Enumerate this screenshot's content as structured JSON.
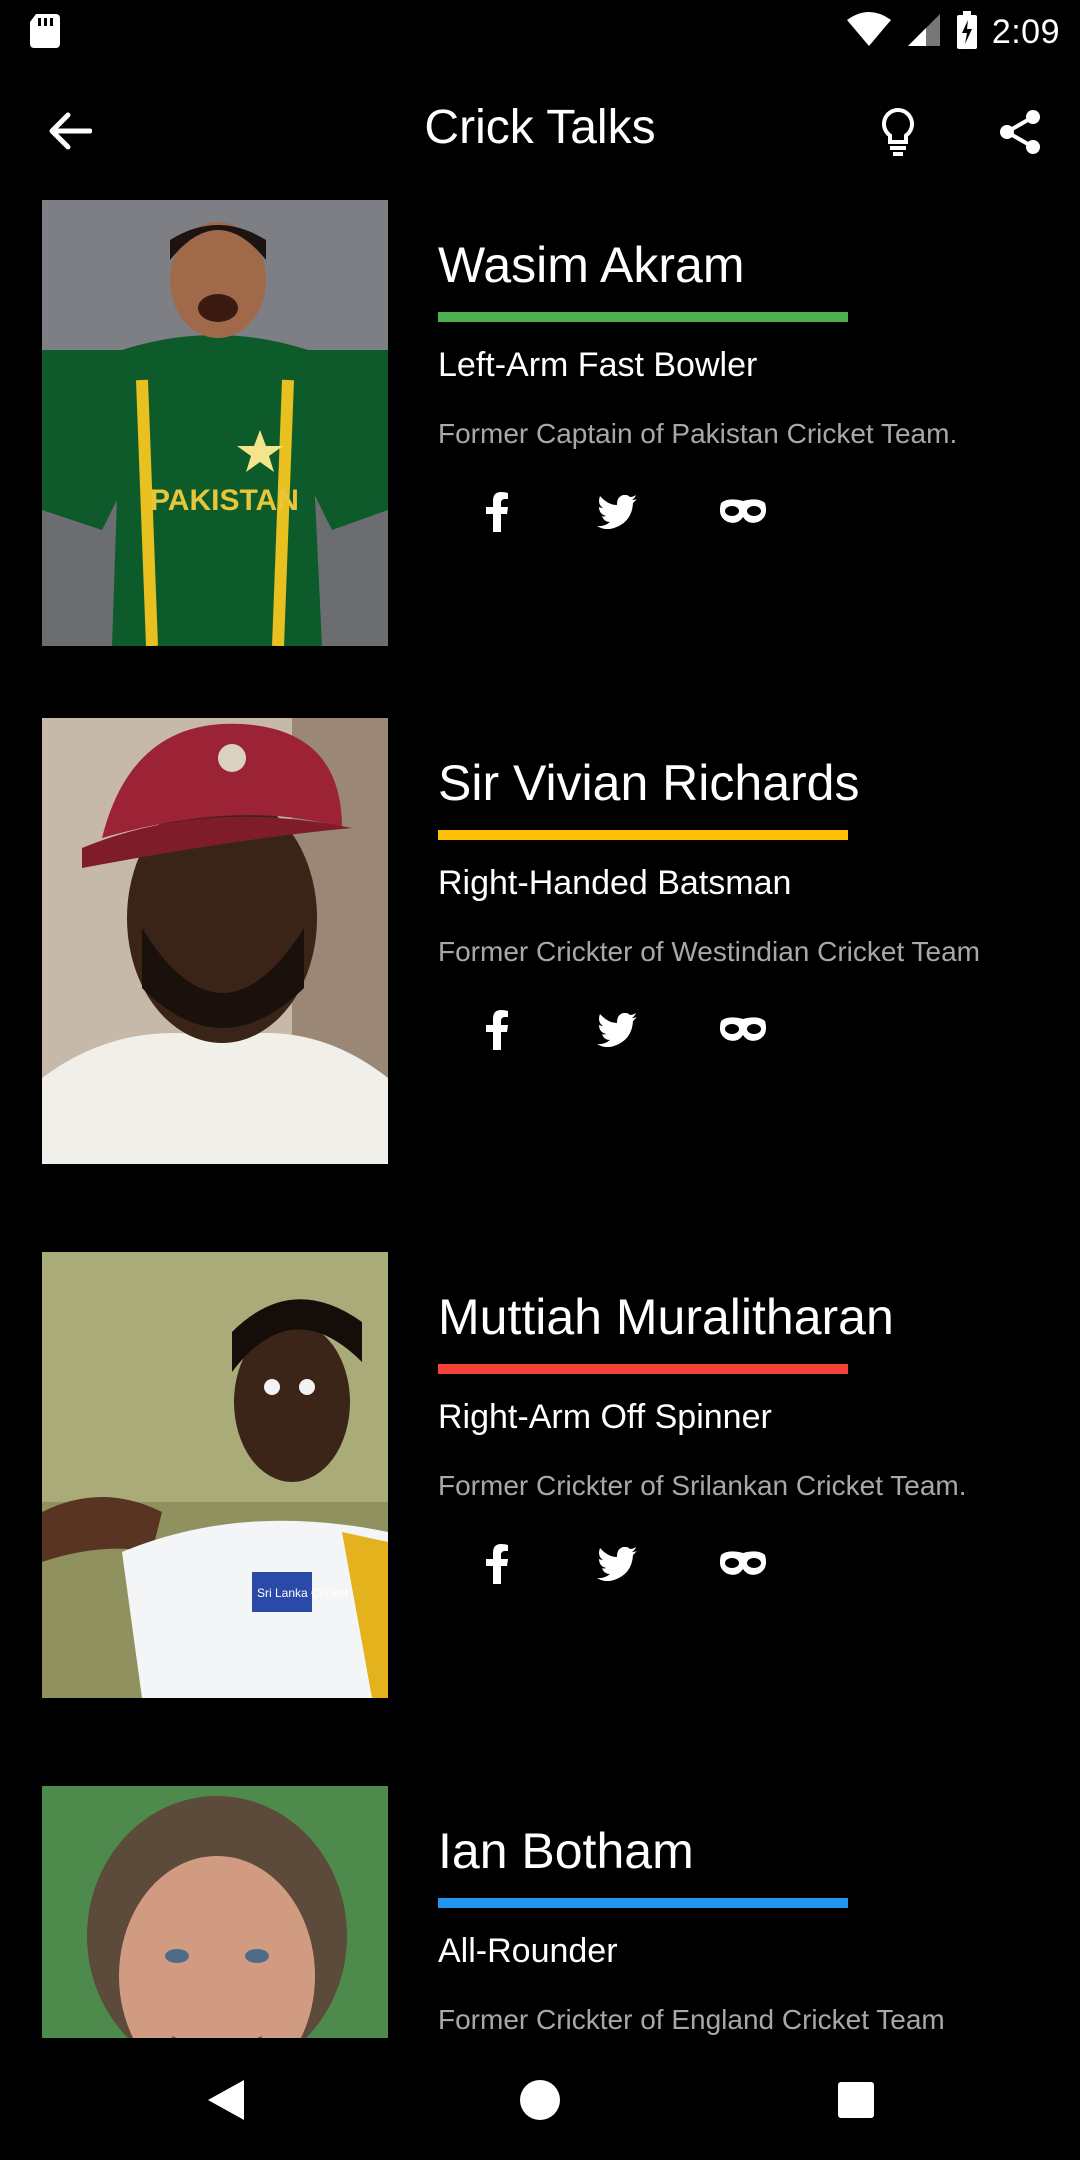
{
  "status_bar": {
    "time": "2:09",
    "icons": [
      "sd-card-icon",
      "wifi-icon",
      "cell-signal-icon",
      "battery-charging-icon"
    ]
  },
  "app_bar": {
    "title": "Crick Talks",
    "icons": [
      "back-arrow-icon",
      "lightbulb-icon",
      "share-icon"
    ]
  },
  "players": [
    {
      "name": "Wasim Akram",
      "role": "Left-Arm Fast Bowler",
      "description": "Former Captain of Pakistan Cricket Team.",
      "accent_color": "#4CAF50",
      "jersey_text": "PAKISTAN"
    },
    {
      "name": "Sir Vivian Richards",
      "role": "Right-Handed Batsman",
      "description": "Former Crickter of Westindian Cricket Team",
      "accent_color": "#FFC107",
      "jersey_text": ""
    },
    {
      "name": "Muttiah Muralitharan",
      "role": "Right-Arm Off Spinner",
      "description": "Former Crickter of Srilankan Cricket Team.",
      "accent_color": "#F44336",
      "jersey_text": "Sri Lanka Cricket"
    },
    {
      "name": "Ian Botham",
      "role": "All-Rounder",
      "description": "Former Crickter of England Cricket Team",
      "accent_color": "#2196F3",
      "jersey_text": ""
    }
  ],
  "social_icons": [
    "facebook-icon",
    "twitter-icon",
    "wikipedia-mask-icon"
  ],
  "nav_bar": {
    "icons": [
      "nav-back-icon",
      "nav-home-icon",
      "nav-recents-icon"
    ]
  }
}
